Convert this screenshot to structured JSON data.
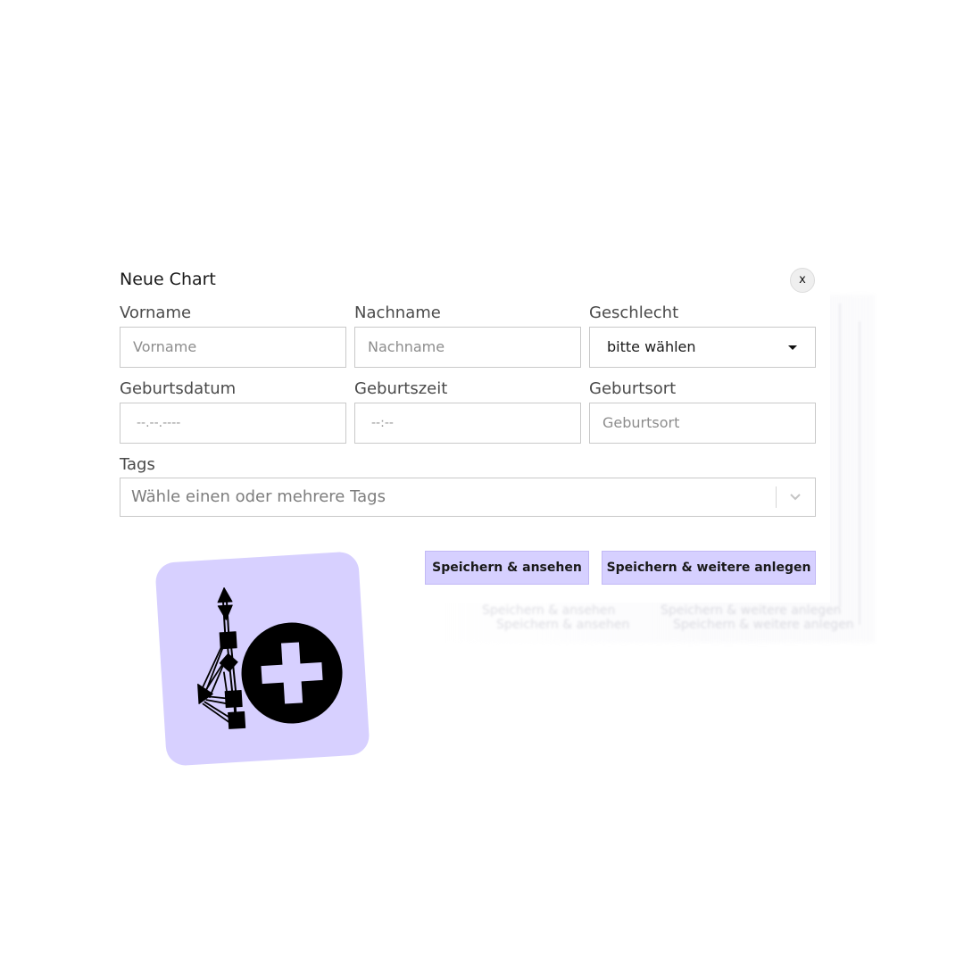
{
  "dialog": {
    "title": "Neue Chart",
    "close_label": "x"
  },
  "fields": {
    "vorname": {
      "label": "Vorname",
      "placeholder": "Vorname"
    },
    "nachname": {
      "label": "Nachname",
      "placeholder": "Nachname"
    },
    "geschlecht": {
      "label": "Geschlecht",
      "value": "bitte wählen"
    },
    "geburtsdatum": {
      "label": "Geburtsdatum",
      "placeholder": "--.--.----"
    },
    "geburtszeit": {
      "label": "Geburtszeit",
      "placeholder": "--:--"
    },
    "geburtsort": {
      "label": "Geburtsort",
      "placeholder": "Geburtsort"
    },
    "tags": {
      "label": "Tags",
      "placeholder": "Wähle einen oder mehrere Tags"
    }
  },
  "actions": {
    "save_view": "Speichern & ansehen",
    "save_more": "Speichern & weitere anlegen"
  },
  "icons": {
    "dropdown": "caret-down-icon",
    "tags_dropdown": "chevron-down-icon",
    "app_icon": "bodygraph-add-icon"
  },
  "colors": {
    "accent": "#d6d0ff",
    "icon_bg": "#d7d0ff",
    "border": "#c9c9c9"
  }
}
